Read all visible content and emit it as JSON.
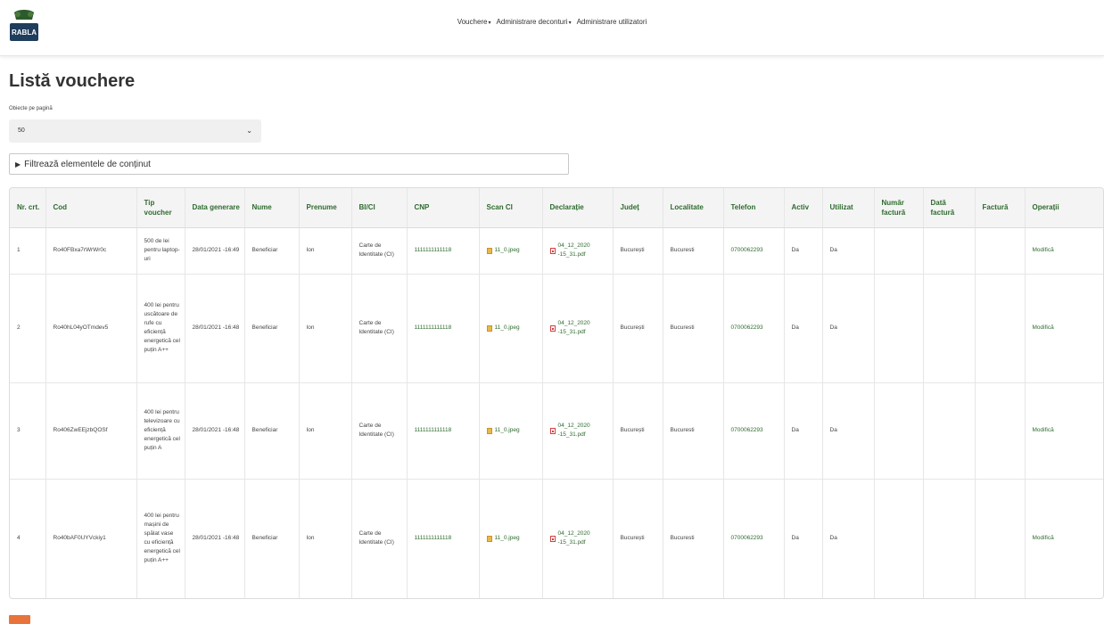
{
  "header": {
    "logo_text": "RABLA",
    "nav": [
      {
        "label": "Vouchere",
        "caret": "▾"
      },
      {
        "label": "Administrare deconturi",
        "caret": "▾"
      },
      {
        "label": "Administrare utilizatori",
        "caret": ""
      }
    ]
  },
  "page": {
    "title": "Listă vouchere",
    "per_page_label": "Obiecte pe pagină",
    "per_page_value": "50",
    "filter_label": "Filtrează elementele de conținut"
  },
  "table": {
    "columns": [
      "Nr. crt.",
      "Cod",
      "Tip voucher",
      "Data generare",
      "Nume",
      "Prenume",
      "BI/CI",
      "CNP",
      "Scan CI",
      "Declarație",
      "Județ",
      "Localitate",
      "Telefon",
      "Activ",
      "Utilizat",
      "Număr factură",
      "Dată factură",
      "Factură",
      "Operații"
    ],
    "rows": [
      {
        "nr": "1",
        "cod": "Ro40FBxa7rWrWr0c",
        "tip": "500 de lei pentru laptop-uri",
        "data": "28/01/2021 -16:49",
        "nume": "Beneficiar",
        "prenume": "Ion",
        "bici": "Carte de Identitate (CI)",
        "cnp": "1111111111118",
        "scan": "11_0.jpeg",
        "decl": "04_12_2020 -15_31.pdf",
        "judet": "București",
        "localitate": "Bucuresti",
        "telefon": "0700062293",
        "activ": "Da",
        "utilizat": "Da",
        "numar_factura": "",
        "data_factura": "",
        "factura": "",
        "operatii": "Modifică"
      },
      {
        "nr": "2",
        "cod": "Ro40hL04yOTmdev5",
        "tip": "400 lei pentru uscătoare de rufe cu eficiență energetică cel puțin A++",
        "data": "28/01/2021 -16:48",
        "nume": "Beneficiar",
        "prenume": "Ion",
        "bici": "Carte de Identitate (CI)",
        "cnp": "1111111111118",
        "scan": "11_0.jpeg",
        "decl": "04_12_2020 -15_31.pdf",
        "judet": "București",
        "localitate": "Bucuresti",
        "telefon": "0700062293",
        "activ": "Da",
        "utilizat": "Da",
        "numar_factura": "",
        "data_factura": "",
        "factura": "",
        "operatii": "Modifică"
      },
      {
        "nr": "3",
        "cod": "Ro406ZwEEjzbQOSf",
        "tip": "400 lei pentru televizoare cu eficiență energetică cel puțin A",
        "data": "28/01/2021 -16:48",
        "nume": "Beneficiar",
        "prenume": "Ion",
        "bici": "Carte de Identitate (CI)",
        "cnp": "1111111111118",
        "scan": "11_0.jpeg",
        "decl": "04_12_2020 -15_31.pdf",
        "judet": "București",
        "localitate": "Bucuresti",
        "telefon": "0700062293",
        "activ": "Da",
        "utilizat": "Da",
        "numar_factura": "",
        "data_factura": "",
        "factura": "",
        "operatii": "Modifică"
      },
      {
        "nr": "4",
        "cod": "Ro40bAF0UYVckiy1",
        "tip": "400 lei pentru mașini de spălat vase cu eficiență energetică cel puțin A++",
        "data": "28/01/2021 -16:48",
        "nume": "Beneficiar",
        "prenume": "Ion",
        "bici": "Carte de Identitate (CI)",
        "cnp": "1111111111118",
        "scan": "11_0.jpeg",
        "decl": "04_12_2020 -15_31.pdf",
        "judet": "București",
        "localitate": "Bucuresti",
        "telefon": "0700062293",
        "activ": "Da",
        "utilizat": "Da",
        "numar_factura": "",
        "data_factura": "",
        "factura": "",
        "operatii": "Modifică"
      }
    ]
  },
  "colors": {
    "accent": "#2e6b2e",
    "header_bg": "#f4f4f4"
  }
}
